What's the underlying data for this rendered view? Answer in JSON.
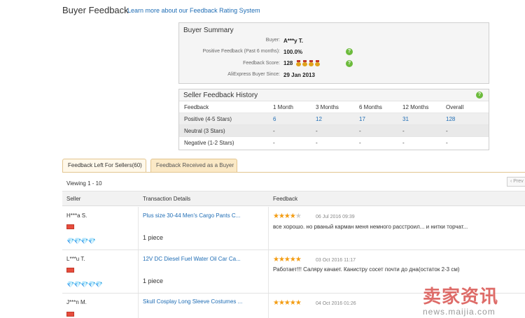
{
  "header": {
    "title": "Buyer Feedback",
    "link": "Learn more about our Feedback Rating System"
  },
  "summary": {
    "title": "Buyer Summary",
    "buyer_label": "Buyer:",
    "buyer_value": "A***y T.",
    "positive_label": "Positive Feedback (Past 6 months):",
    "positive_value": "100.0%",
    "score_label": "Feedback Score:",
    "score_value": "128",
    "since_label": "AliExpress Buyer Since:",
    "since_value": "29 Jan 2013",
    "medal_count": 4
  },
  "history": {
    "title": "Seller Feedback History",
    "columns": [
      "Feedback",
      "1 Month",
      "3 Months",
      "6 Months",
      "12 Months",
      "Overall"
    ],
    "rows": [
      {
        "label": "Positive (4-5 Stars)",
        "values": [
          "6",
          "12",
          "17",
          "31",
          "128"
        ]
      },
      {
        "label": "Neutral (3 Stars)",
        "values": [
          "-",
          "-",
          "-",
          "-",
          "-"
        ]
      },
      {
        "label": "Negative (1-2 Stars)",
        "values": [
          "-",
          "-",
          "-",
          "-",
          "-"
        ]
      }
    ]
  },
  "tabs": [
    {
      "label": "Feedback Left For Sellers(60)",
      "active": true
    },
    {
      "label": "Feedback Received as a Buyer",
      "active": false
    }
  ],
  "viewing": "Viewing 1 - 10",
  "prev_label": "Prev",
  "table": {
    "headers": [
      "Seller",
      "Transaction Details",
      "Feedback"
    ],
    "rows": [
      {
        "seller": "H***a S.",
        "diamonds": "💎💎💎💎",
        "product": "Plus size 30-44 Men's Cargo Pants C...",
        "qty": "1 piece",
        "stars": 4,
        "date": "06 Jul 2016 09:39",
        "text": "все хорошо. но рваный карман меня немного расстроил... и нитки торчат..."
      },
      {
        "seller": "L***u T.",
        "diamonds": "💎💎💎💎💎",
        "product": "12V DC Diesel Fuel Water Oil Car Ca...",
        "qty": "1 piece",
        "stars": 5,
        "date": "03 Oct 2016 11:17",
        "text": "Работает!!! Саляру качает. Канистру сосет почти до дна(остаток 2-3 см)"
      },
      {
        "seller": "J***n M.",
        "diamonds": "",
        "product": "Skull Cosplay Long Sleeve Costumes ...",
        "qty": "",
        "stars": 5,
        "date": "04 Oct 2016 01:26",
        "text": ""
      }
    ]
  },
  "watermark": {
    "cn": "卖家资讯",
    "url": "news.maijia.com"
  },
  "colors": {
    "link": "#1f6db5",
    "star": "#f39c12",
    "tab_border": "#e3c58f",
    "help": "#6cbb3c"
  }
}
